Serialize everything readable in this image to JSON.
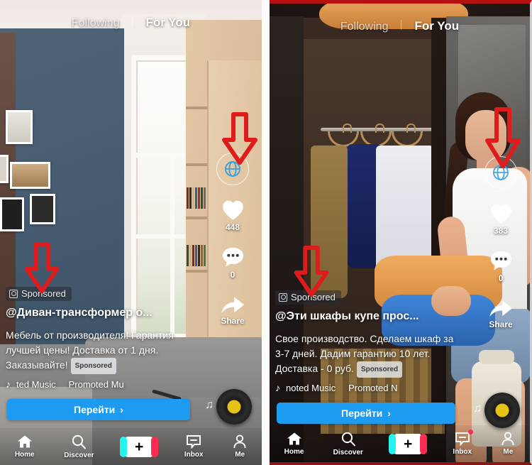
{
  "meta": {
    "layout": "two side-by-side TikTok in-feed ad screenshots with red annotation arrows",
    "accent_blue": "#1d9bf0",
    "annotation_red": "#e01b1b",
    "tiktok_cyan": "#25f4ee",
    "tiktok_pink": "#fe2c55"
  },
  "panels": [
    {
      "id": "left",
      "header": {
        "following_tab": "Following",
        "foryou_tab": "For You"
      },
      "rail": {
        "globe_icon": "globe-icon",
        "like_icon": "heart-icon",
        "like_count": "448",
        "comment_icon": "comment-icon",
        "comment_count": "0",
        "share_icon": "share-arrow-icon",
        "share_label": "Share"
      },
      "ad": {
        "sponsored_badge": "Sponsored",
        "handle": "@Диван-трансформер о...",
        "description_line1": "Мебель от производителя! Гарантия",
        "description_line2": "лучшей цены! Доставка от 1 дня.",
        "description_line3": "Заказывайте!",
        "inline_sponsored": "Sponsored",
        "cta_label": "Перейти",
        "cta_chevron": "›"
      },
      "music": {
        "note_icon": "music-note-icon",
        "track_1": "ted Music",
        "track_2": "Promoted Mu",
        "disc_icon": "vinyl-record-icon"
      },
      "nav": {
        "items": [
          {
            "label": "Home",
            "icon": "home-icon"
          },
          {
            "label": "Discover",
            "icon": "search-icon"
          },
          {
            "label": "",
            "icon": "plus-icon"
          },
          {
            "label": "Inbox",
            "icon": "inbox-message-icon",
            "badge": false
          },
          {
            "label": "Me",
            "icon": "person-icon"
          }
        ]
      },
      "annotations": [
        {
          "name": "arrow-to-globe-icon",
          "direction": "down"
        },
        {
          "name": "arrow-to-sponsored-badge",
          "direction": "down"
        }
      ]
    },
    {
      "id": "right",
      "header": {
        "following_tab": "Following",
        "foryou_tab": "For You"
      },
      "rail": {
        "globe_icon": "globe-icon",
        "like_icon": "heart-icon",
        "like_count": "383",
        "comment_icon": "comment-icon",
        "comment_count": "0",
        "share_icon": "share-arrow-icon",
        "share_label": "Share"
      },
      "ad": {
        "sponsored_badge": "Sponsored",
        "handle": "@Эти шкафы купе прос...",
        "description_line1": "Свое производство. Сделаем шкаф за",
        "description_line2": "3-7 дней. Дадим гарантию 10 лет.",
        "description_line3": "Доставка - 0 руб.",
        "inline_sponsored": "Sponsored",
        "cta_label": "Перейти",
        "cta_chevron": "›"
      },
      "music": {
        "note_icon": "music-note-icon",
        "track_1": "noted Music",
        "track_2": "Promoted N",
        "disc_icon": "vinyl-record-icon"
      },
      "nav": {
        "items": [
          {
            "label": "Home",
            "icon": "home-icon"
          },
          {
            "label": "Discover",
            "icon": "search-icon"
          },
          {
            "label": "",
            "icon": "plus-icon"
          },
          {
            "label": "Inbox",
            "icon": "inbox-message-icon",
            "badge": true
          },
          {
            "label": "Me",
            "icon": "person-icon"
          }
        ]
      },
      "annotations": [
        {
          "name": "arrow-to-globe-icon",
          "direction": "down"
        },
        {
          "name": "arrow-to-sponsored-badge",
          "direction": "down"
        }
      ]
    }
  ]
}
